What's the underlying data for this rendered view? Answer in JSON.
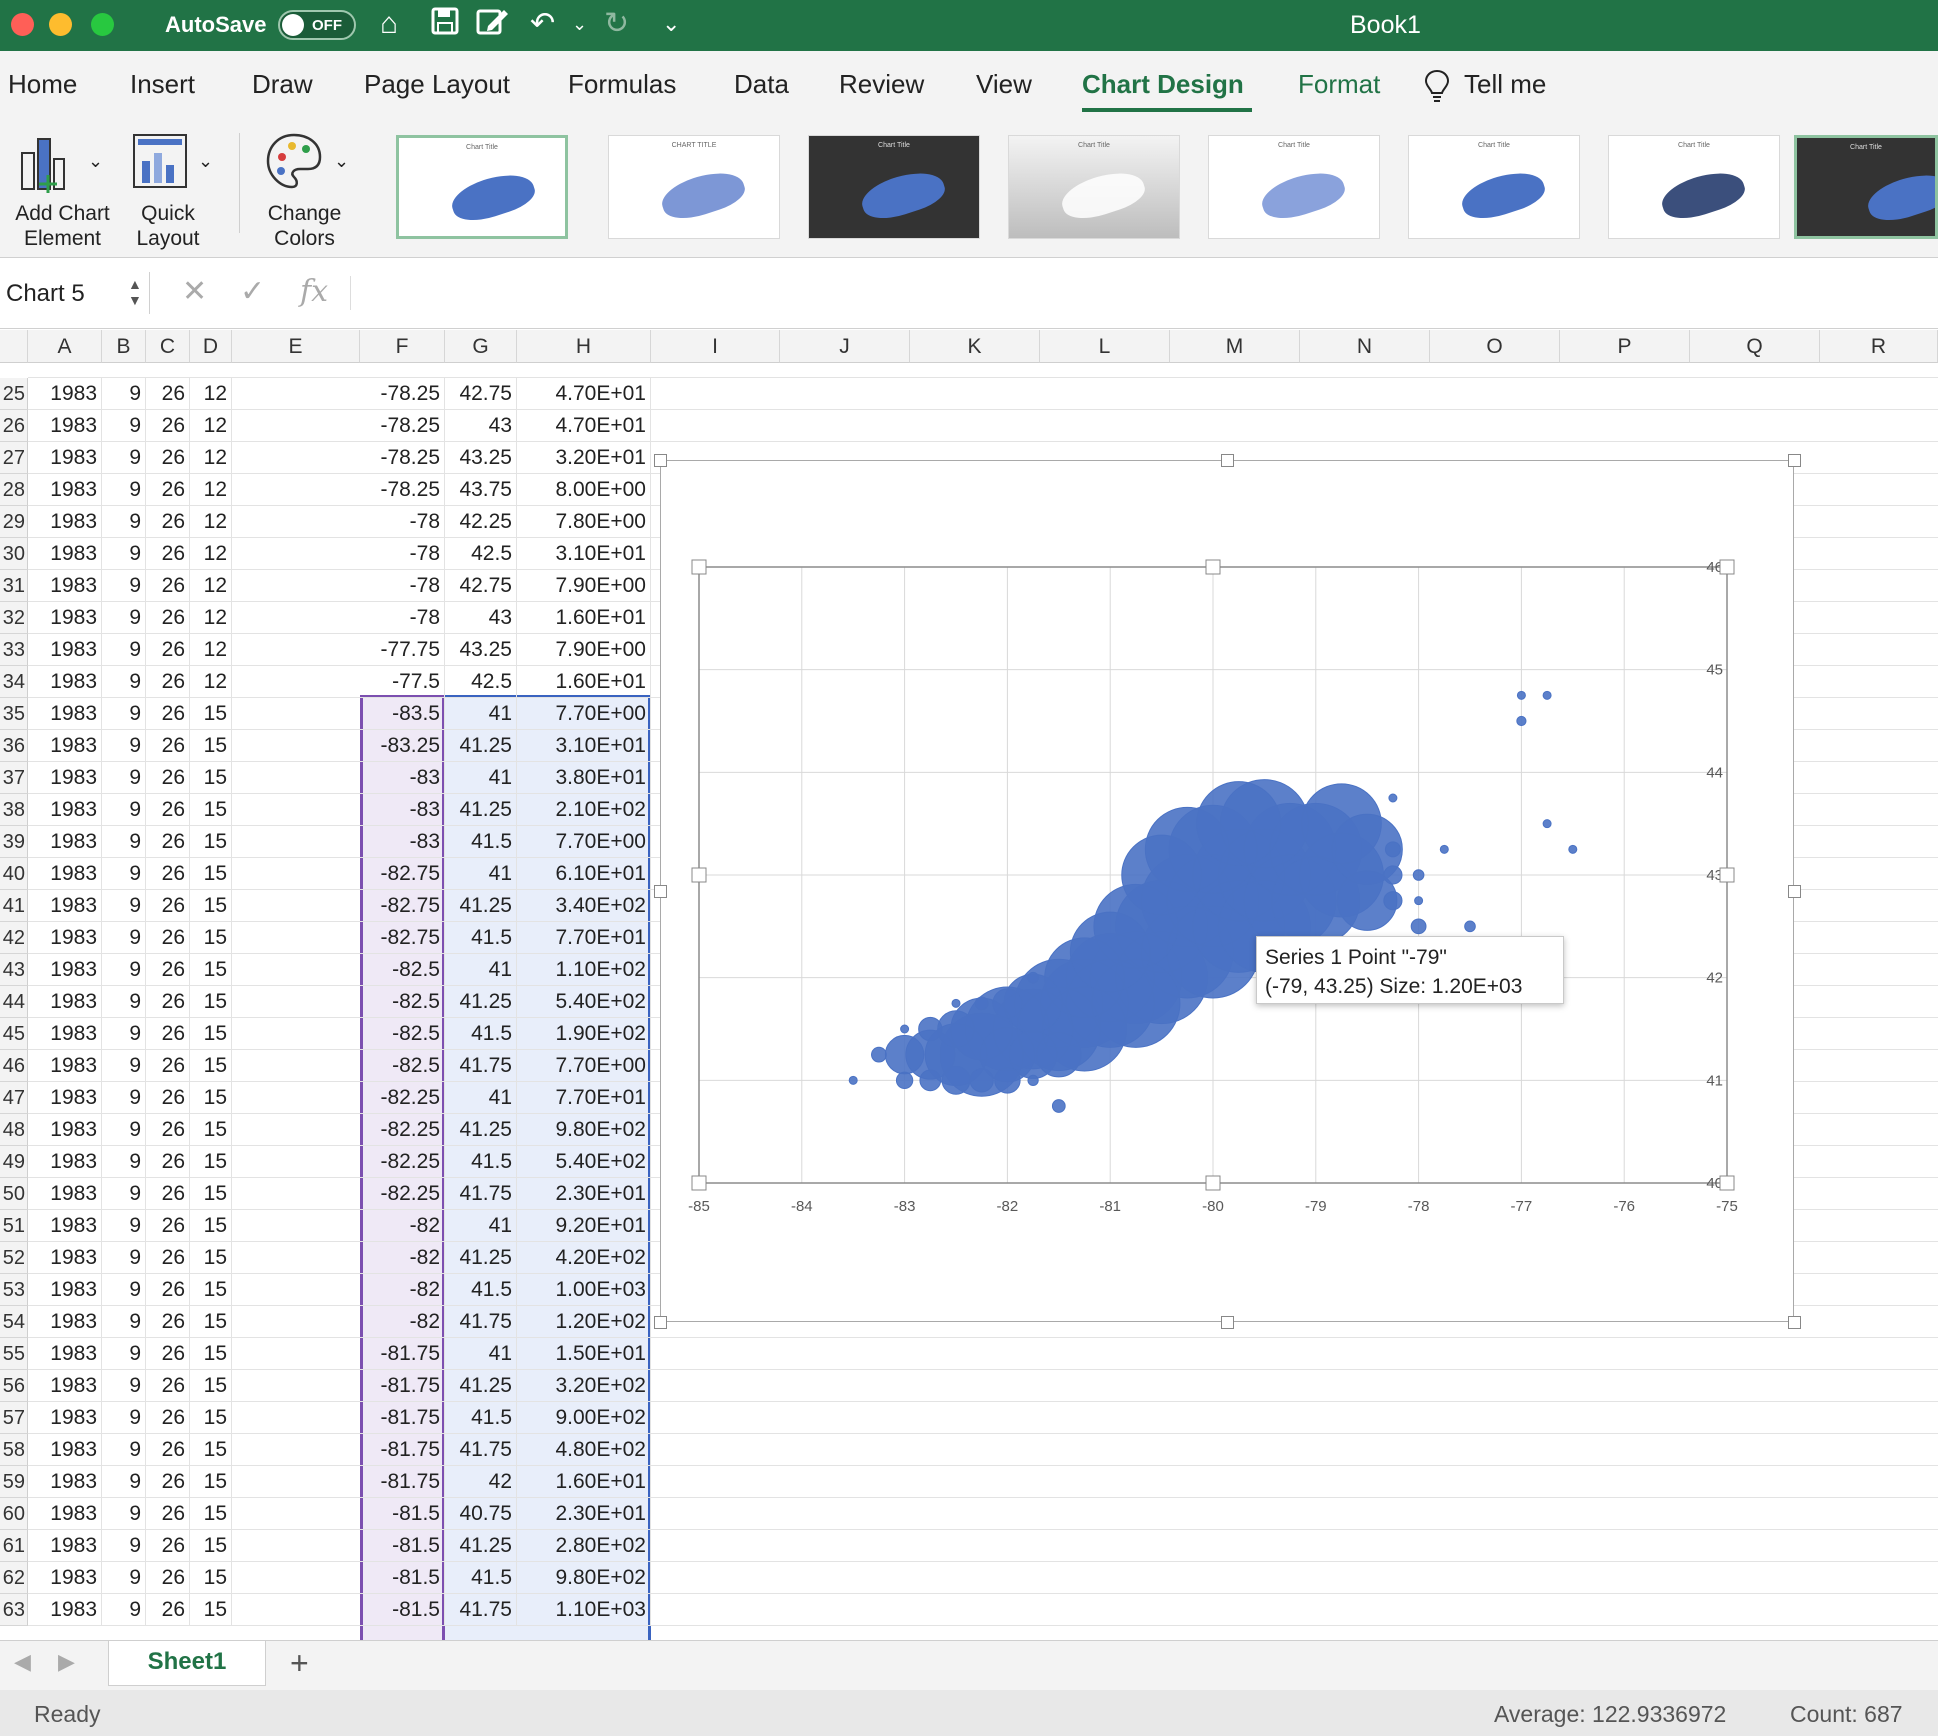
{
  "titlebar": {
    "autosave_label": "AutoSave",
    "autosave_state": "OFF",
    "book_title": "Book1",
    "accent_color": "#217346"
  },
  "ribbon": {
    "tabs": [
      {
        "label": "Home",
        "active": false
      },
      {
        "label": "Insert",
        "active": false
      },
      {
        "label": "Draw",
        "active": false
      },
      {
        "label": "Page Layout",
        "active": false
      },
      {
        "label": "Formulas",
        "active": false
      },
      {
        "label": "Data",
        "active": false
      },
      {
        "label": "Review",
        "active": false
      },
      {
        "label": "View",
        "active": false
      },
      {
        "label": "Chart Design",
        "active": true
      },
      {
        "label": "Format",
        "active": false
      },
      {
        "label": "Tell me",
        "active": false
      }
    ],
    "add_chart_element": {
      "line1": "Add Chart",
      "line2": "Element"
    },
    "quick_layout": {
      "line1": "Quick",
      "line2": "Layout"
    },
    "change_colors": {
      "line1": "Change",
      "line2": "Colors"
    },
    "style_thumbs": [
      {
        "title": "Chart Title",
        "variant": "selected"
      },
      {
        "title": "CHART TITLE",
        "variant": "light"
      },
      {
        "title": "Chart Title",
        "variant": "dark"
      },
      {
        "title": "Chart Title",
        "variant": "grey"
      },
      {
        "title": "Chart Title",
        "variant": "light"
      },
      {
        "title": "Chart Title",
        "variant": "light"
      },
      {
        "title": "Chart Title",
        "variant": "light"
      },
      {
        "title": "Chart Title",
        "variant": "dark-selected"
      }
    ]
  },
  "formula_bar": {
    "name_box": "Chart 5",
    "fx_label": "fx",
    "formula": ""
  },
  "columns": [
    "A",
    "B",
    "C",
    "D",
    "E",
    "F",
    "G",
    "H",
    "I",
    "J",
    "K",
    "L",
    "M",
    "N",
    "O",
    "P",
    "Q",
    "R"
  ],
  "rows": [
    {
      "num": "25",
      "a": "1983",
      "b": "9",
      "c": "26",
      "d": "12",
      "f": "-78.25",
      "g": "42.75",
      "h": "4.70E+01"
    },
    {
      "num": "26",
      "a": "1983",
      "b": "9",
      "c": "26",
      "d": "12",
      "f": "-78.25",
      "g": "43",
      "h": "4.70E+01"
    },
    {
      "num": "27",
      "a": "1983",
      "b": "9",
      "c": "26",
      "d": "12",
      "f": "-78.25",
      "g": "43.25",
      "h": "3.20E+01"
    },
    {
      "num": "28",
      "a": "1983",
      "b": "9",
      "c": "26",
      "d": "12",
      "f": "-78.25",
      "g": "43.75",
      "h": "8.00E+00"
    },
    {
      "num": "29",
      "a": "1983",
      "b": "9",
      "c": "26",
      "d": "12",
      "f": "-78",
      "g": "42.25",
      "h": "7.80E+00"
    },
    {
      "num": "30",
      "a": "1983",
      "b": "9",
      "c": "26",
      "d": "12",
      "f": "-78",
      "g": "42.5",
      "h": "3.10E+01"
    },
    {
      "num": "31",
      "a": "1983",
      "b": "9",
      "c": "26",
      "d": "12",
      "f": "-78",
      "g": "42.75",
      "h": "7.90E+00"
    },
    {
      "num": "32",
      "a": "1983",
      "b": "9",
      "c": "26",
      "d": "12",
      "f": "-78",
      "g": "43",
      "h": "1.60E+01"
    },
    {
      "num": "33",
      "a": "1983",
      "b": "9",
      "c": "26",
      "d": "12",
      "f": "-77.75",
      "g": "43.25",
      "h": "7.90E+00"
    },
    {
      "num": "34",
      "a": "1983",
      "b": "9",
      "c": "26",
      "d": "12",
      "f": "-77.5",
      "g": "42.5",
      "h": "1.60E+01"
    },
    {
      "num": "35",
      "a": "1983",
      "b": "9",
      "c": "26",
      "d": "15",
      "f": "-83.5",
      "g": "41",
      "h": "7.70E+00"
    },
    {
      "num": "36",
      "a": "1983",
      "b": "9",
      "c": "26",
      "d": "15",
      "f": "-83.25",
      "g": "41.25",
      "h": "3.10E+01"
    },
    {
      "num": "37",
      "a": "1983",
      "b": "9",
      "c": "26",
      "d": "15",
      "f": "-83",
      "g": "41",
      "h": "3.80E+01"
    },
    {
      "num": "38",
      "a": "1983",
      "b": "9",
      "c": "26",
      "d": "15",
      "f": "-83",
      "g": "41.25",
      "h": "2.10E+02"
    },
    {
      "num": "39",
      "a": "1983",
      "b": "9",
      "c": "26",
      "d": "15",
      "f": "-83",
      "g": "41.5",
      "h": "7.70E+00"
    },
    {
      "num": "40",
      "a": "1983",
      "b": "9",
      "c": "26",
      "d": "15",
      "f": "-82.75",
      "g": "41",
      "h": "6.10E+01"
    },
    {
      "num": "41",
      "a": "1983",
      "b": "9",
      "c": "26",
      "d": "15",
      "f": "-82.75",
      "g": "41.25",
      "h": "3.40E+02"
    },
    {
      "num": "42",
      "a": "1983",
      "b": "9",
      "c": "26",
      "d": "15",
      "f": "-82.75",
      "g": "41.5",
      "h": "7.70E+01"
    },
    {
      "num": "43",
      "a": "1983",
      "b": "9",
      "c": "26",
      "d": "15",
      "f": "-82.5",
      "g": "41",
      "h": "1.10E+02"
    },
    {
      "num": "44",
      "a": "1983",
      "b": "9",
      "c": "26",
      "d": "15",
      "f": "-82.5",
      "g": "41.25",
      "h": "5.40E+02"
    },
    {
      "num": "45",
      "a": "1983",
      "b": "9",
      "c": "26",
      "d": "15",
      "f": "-82.5",
      "g": "41.5",
      "h": "1.90E+02"
    },
    {
      "num": "46",
      "a": "1983",
      "b": "9",
      "c": "26",
      "d": "15",
      "f": "-82.5",
      "g": "41.75",
      "h": "7.70E+00"
    },
    {
      "num": "47",
      "a": "1983",
      "b": "9",
      "c": "26",
      "d": "15",
      "f": "-82.25",
      "g": "41",
      "h": "7.70E+01"
    },
    {
      "num": "48",
      "a": "1983",
      "b": "9",
      "c": "26",
      "d": "15",
      "f": "-82.25",
      "g": "41.25",
      "h": "9.80E+02"
    },
    {
      "num": "49",
      "a": "1983",
      "b": "9",
      "c": "26",
      "d": "15",
      "f": "-82.25",
      "g": "41.5",
      "h": "5.40E+02"
    },
    {
      "num": "50",
      "a": "1983",
      "b": "9",
      "c": "26",
      "d": "15",
      "f": "-82.25",
      "g": "41.75",
      "h": "2.30E+01"
    },
    {
      "num": "51",
      "a": "1983",
      "b": "9",
      "c": "26",
      "d": "15",
      "f": "-82",
      "g": "41",
      "h": "9.20E+01"
    },
    {
      "num": "52",
      "a": "1983",
      "b": "9",
      "c": "26",
      "d": "15",
      "f": "-82",
      "g": "41.25",
      "h": "4.20E+02"
    },
    {
      "num": "53",
      "a": "1983",
      "b": "9",
      "c": "26",
      "d": "15",
      "f": "-82",
      "g": "41.5",
      "h": "1.00E+03"
    },
    {
      "num": "54",
      "a": "1983",
      "b": "9",
      "c": "26",
      "d": "15",
      "f": "-82",
      "g": "41.75",
      "h": "1.20E+02"
    },
    {
      "num": "55",
      "a": "1983",
      "b": "9",
      "c": "26",
      "d": "15",
      "f": "-81.75",
      "g": "41",
      "h": "1.50E+01"
    },
    {
      "num": "56",
      "a": "1983",
      "b": "9",
      "c": "26",
      "d": "15",
      "f": "-81.75",
      "g": "41.25",
      "h": "3.20E+02"
    },
    {
      "num": "57",
      "a": "1983",
      "b": "9",
      "c": "26",
      "d": "15",
      "f": "-81.75",
      "g": "41.5",
      "h": "9.00E+02"
    },
    {
      "num": "58",
      "a": "1983",
      "b": "9",
      "c": "26",
      "d": "15",
      "f": "-81.75",
      "g": "41.75",
      "h": "4.80E+02"
    },
    {
      "num": "59",
      "a": "1983",
      "b": "9",
      "c": "26",
      "d": "15",
      "f": "-81.75",
      "g": "42",
      "h": "1.60E+01"
    },
    {
      "num": "60",
      "a": "1983",
      "b": "9",
      "c": "26",
      "d": "15",
      "f": "-81.5",
      "g": "40.75",
      "h": "2.30E+01"
    },
    {
      "num": "61",
      "a": "1983",
      "b": "9",
      "c": "26",
      "d": "15",
      "f": "-81.5",
      "g": "41.25",
      "h": "2.80E+02"
    },
    {
      "num": "62",
      "a": "1983",
      "b": "9",
      "c": "26",
      "d": "15",
      "f": "-81.5",
      "g": "41.5",
      "h": "9.80E+02"
    },
    {
      "num": "63",
      "a": "1983",
      "b": "9",
      "c": "26",
      "d": "15",
      "f": "-81.5",
      "g": "41.75",
      "h": "1.10E+03"
    }
  ],
  "chart_data": {
    "type": "scatter",
    "subtype": "bubble",
    "title": "",
    "xlabel": "",
    "ylabel": "",
    "xlim": [
      -85,
      -75
    ],
    "ylim": [
      40,
      46
    ],
    "x_ticks": [
      "-85",
      "-84",
      "-83",
      "-82",
      "-81",
      "-80",
      "-79",
      "-78",
      "-77",
      "-76",
      "-75"
    ],
    "y_ticks": [
      "40",
      "41",
      "42",
      "43",
      "44",
      "45",
      "46"
    ],
    "y_axis_side": "right",
    "grid": true,
    "legend": "none",
    "series_color": "#4a72c4",
    "series": [
      {
        "points": [
          {
            "x": -83.5,
            "y": 41,
            "size": 7.7
          },
          {
            "x": -83.25,
            "y": 41.25,
            "size": 31
          },
          {
            "x": -83,
            "y": 41,
            "size": 38
          },
          {
            "x": -83,
            "y": 41.25,
            "size": 210
          },
          {
            "x": -83,
            "y": 41.5,
            "size": 7.7
          },
          {
            "x": -82.75,
            "y": 41,
            "size": 61
          },
          {
            "x": -82.75,
            "y": 41.25,
            "size": 340
          },
          {
            "x": -82.75,
            "y": 41.5,
            "size": 77
          },
          {
            "x": -82.5,
            "y": 41,
            "size": 110
          },
          {
            "x": -82.5,
            "y": 41.25,
            "size": 540
          },
          {
            "x": -82.5,
            "y": 41.5,
            "size": 190
          },
          {
            "x": -82.5,
            "y": 41.75,
            "size": 7.7
          },
          {
            "x": -82.25,
            "y": 41,
            "size": 77
          },
          {
            "x": -82.25,
            "y": 41.25,
            "size": 980
          },
          {
            "x": -82.25,
            "y": 41.5,
            "size": 540
          },
          {
            "x": -82.25,
            "y": 41.75,
            "size": 23
          },
          {
            "x": -82,
            "y": 41,
            "size": 92
          },
          {
            "x": -82,
            "y": 41.25,
            "size": 420
          },
          {
            "x": -82,
            "y": 41.5,
            "size": 1000
          },
          {
            "x": -82,
            "y": 41.75,
            "size": 120
          },
          {
            "x": -81.75,
            "y": 41,
            "size": 15
          },
          {
            "x": -81.75,
            "y": 41.25,
            "size": 320
          },
          {
            "x": -81.75,
            "y": 41.5,
            "size": 900
          },
          {
            "x": -81.75,
            "y": 41.75,
            "size": 480
          },
          {
            "x": -81.75,
            "y": 42,
            "size": 16
          },
          {
            "x": -81.5,
            "y": 40.75,
            "size": 23
          },
          {
            "x": -81.5,
            "y": 41.25,
            "size": 280
          },
          {
            "x": -81.5,
            "y": 41.5,
            "size": 980
          },
          {
            "x": -81.5,
            "y": 41.75,
            "size": 1100
          },
          {
            "x": -81.25,
            "y": 41.5,
            "size": 1000
          },
          {
            "x": -81.25,
            "y": 41.75,
            "size": 1100
          },
          {
            "x": -81.25,
            "y": 42,
            "size": 900
          },
          {
            "x": -81,
            "y": 41.75,
            "size": 1100
          },
          {
            "x": -81,
            "y": 42,
            "size": 1100
          },
          {
            "x": -81,
            "y": 42.25,
            "size": 900
          },
          {
            "x": -80.75,
            "y": 41.75,
            "size": 1100
          },
          {
            "x": -80.75,
            "y": 42,
            "size": 1200
          },
          {
            "x": -80.75,
            "y": 42.5,
            "size": 1000
          },
          {
            "x": -80.5,
            "y": 42,
            "size": 1200
          },
          {
            "x": -80.5,
            "y": 42.5,
            "size": 1200
          },
          {
            "x": -80.5,
            "y": 43,
            "size": 900
          },
          {
            "x": -80.25,
            "y": 42.25,
            "size": 1200
          },
          {
            "x": -80.25,
            "y": 42.75,
            "size": 1200
          },
          {
            "x": -80.25,
            "y": 43.25,
            "size": 1000
          },
          {
            "x": -80,
            "y": 42.25,
            "size": 1200
          },
          {
            "x": -80,
            "y": 42.75,
            "size": 1200
          },
          {
            "x": -80,
            "y": 43.25,
            "size": 1100
          },
          {
            "x": -79.75,
            "y": 42.5,
            "size": 1200
          },
          {
            "x": -79.75,
            "y": 43,
            "size": 1200
          },
          {
            "x": -79.75,
            "y": 43.5,
            "size": 1000
          },
          {
            "x": -79.5,
            "y": 42.5,
            "size": 1200
          },
          {
            "x": -79.5,
            "y": 43,
            "size": 1200
          },
          {
            "x": -79.5,
            "y": 43.5,
            "size": 1100
          },
          {
            "x": -79.25,
            "y": 42.75,
            "size": 1200
          },
          {
            "x": -79.25,
            "y": 43.25,
            "size": 1200
          },
          {
            "x": -79,
            "y": 43.25,
            "size": 1200
          },
          {
            "x": -79,
            "y": 42.75,
            "size": 1100
          },
          {
            "x": -78.75,
            "y": 43,
            "size": 1000
          },
          {
            "x": -78.75,
            "y": 43.5,
            "size": 900
          },
          {
            "x": -78.5,
            "y": 43.25,
            "size": 700
          },
          {
            "x": -78.5,
            "y": 42.75,
            "size": 500
          },
          {
            "x": -78.25,
            "y": 42.75,
            "size": 47
          },
          {
            "x": -78.25,
            "y": 43,
            "size": 47
          },
          {
            "x": -78.25,
            "y": 43.25,
            "size": 32
          },
          {
            "x": -78.25,
            "y": 43.75,
            "size": 8
          },
          {
            "x": -78,
            "y": 42.25,
            "size": 7.8
          },
          {
            "x": -78,
            "y": 42.5,
            "size": 31
          },
          {
            "x": -78,
            "y": 42.75,
            "size": 7.9
          },
          {
            "x": -78,
            "y": 43,
            "size": 16
          },
          {
            "x": -77.75,
            "y": 43.25,
            "size": 7.9
          },
          {
            "x": -77.5,
            "y": 42.5,
            "size": 16
          },
          {
            "x": -77,
            "y": 44.5,
            "size": 12
          },
          {
            "x": -77,
            "y": 44.75,
            "size": 5
          },
          {
            "x": -76.75,
            "y": 44.75,
            "size": 5
          },
          {
            "x": -76.75,
            "y": 43.5,
            "size": 5
          },
          {
            "x": -76.5,
            "y": 43.25,
            "size": 5
          }
        ]
      }
    ]
  },
  "tooltip": {
    "line1": "Series 1 Point \"-79\"",
    "line2": "(-79, 43.25) Size: 1.20E+03"
  },
  "sheet_tabs": {
    "active": "Sheet1",
    "add": "+"
  },
  "status": {
    "ready": "Ready",
    "average": "Average: 122.9336972",
    "count": "Count: 687"
  }
}
